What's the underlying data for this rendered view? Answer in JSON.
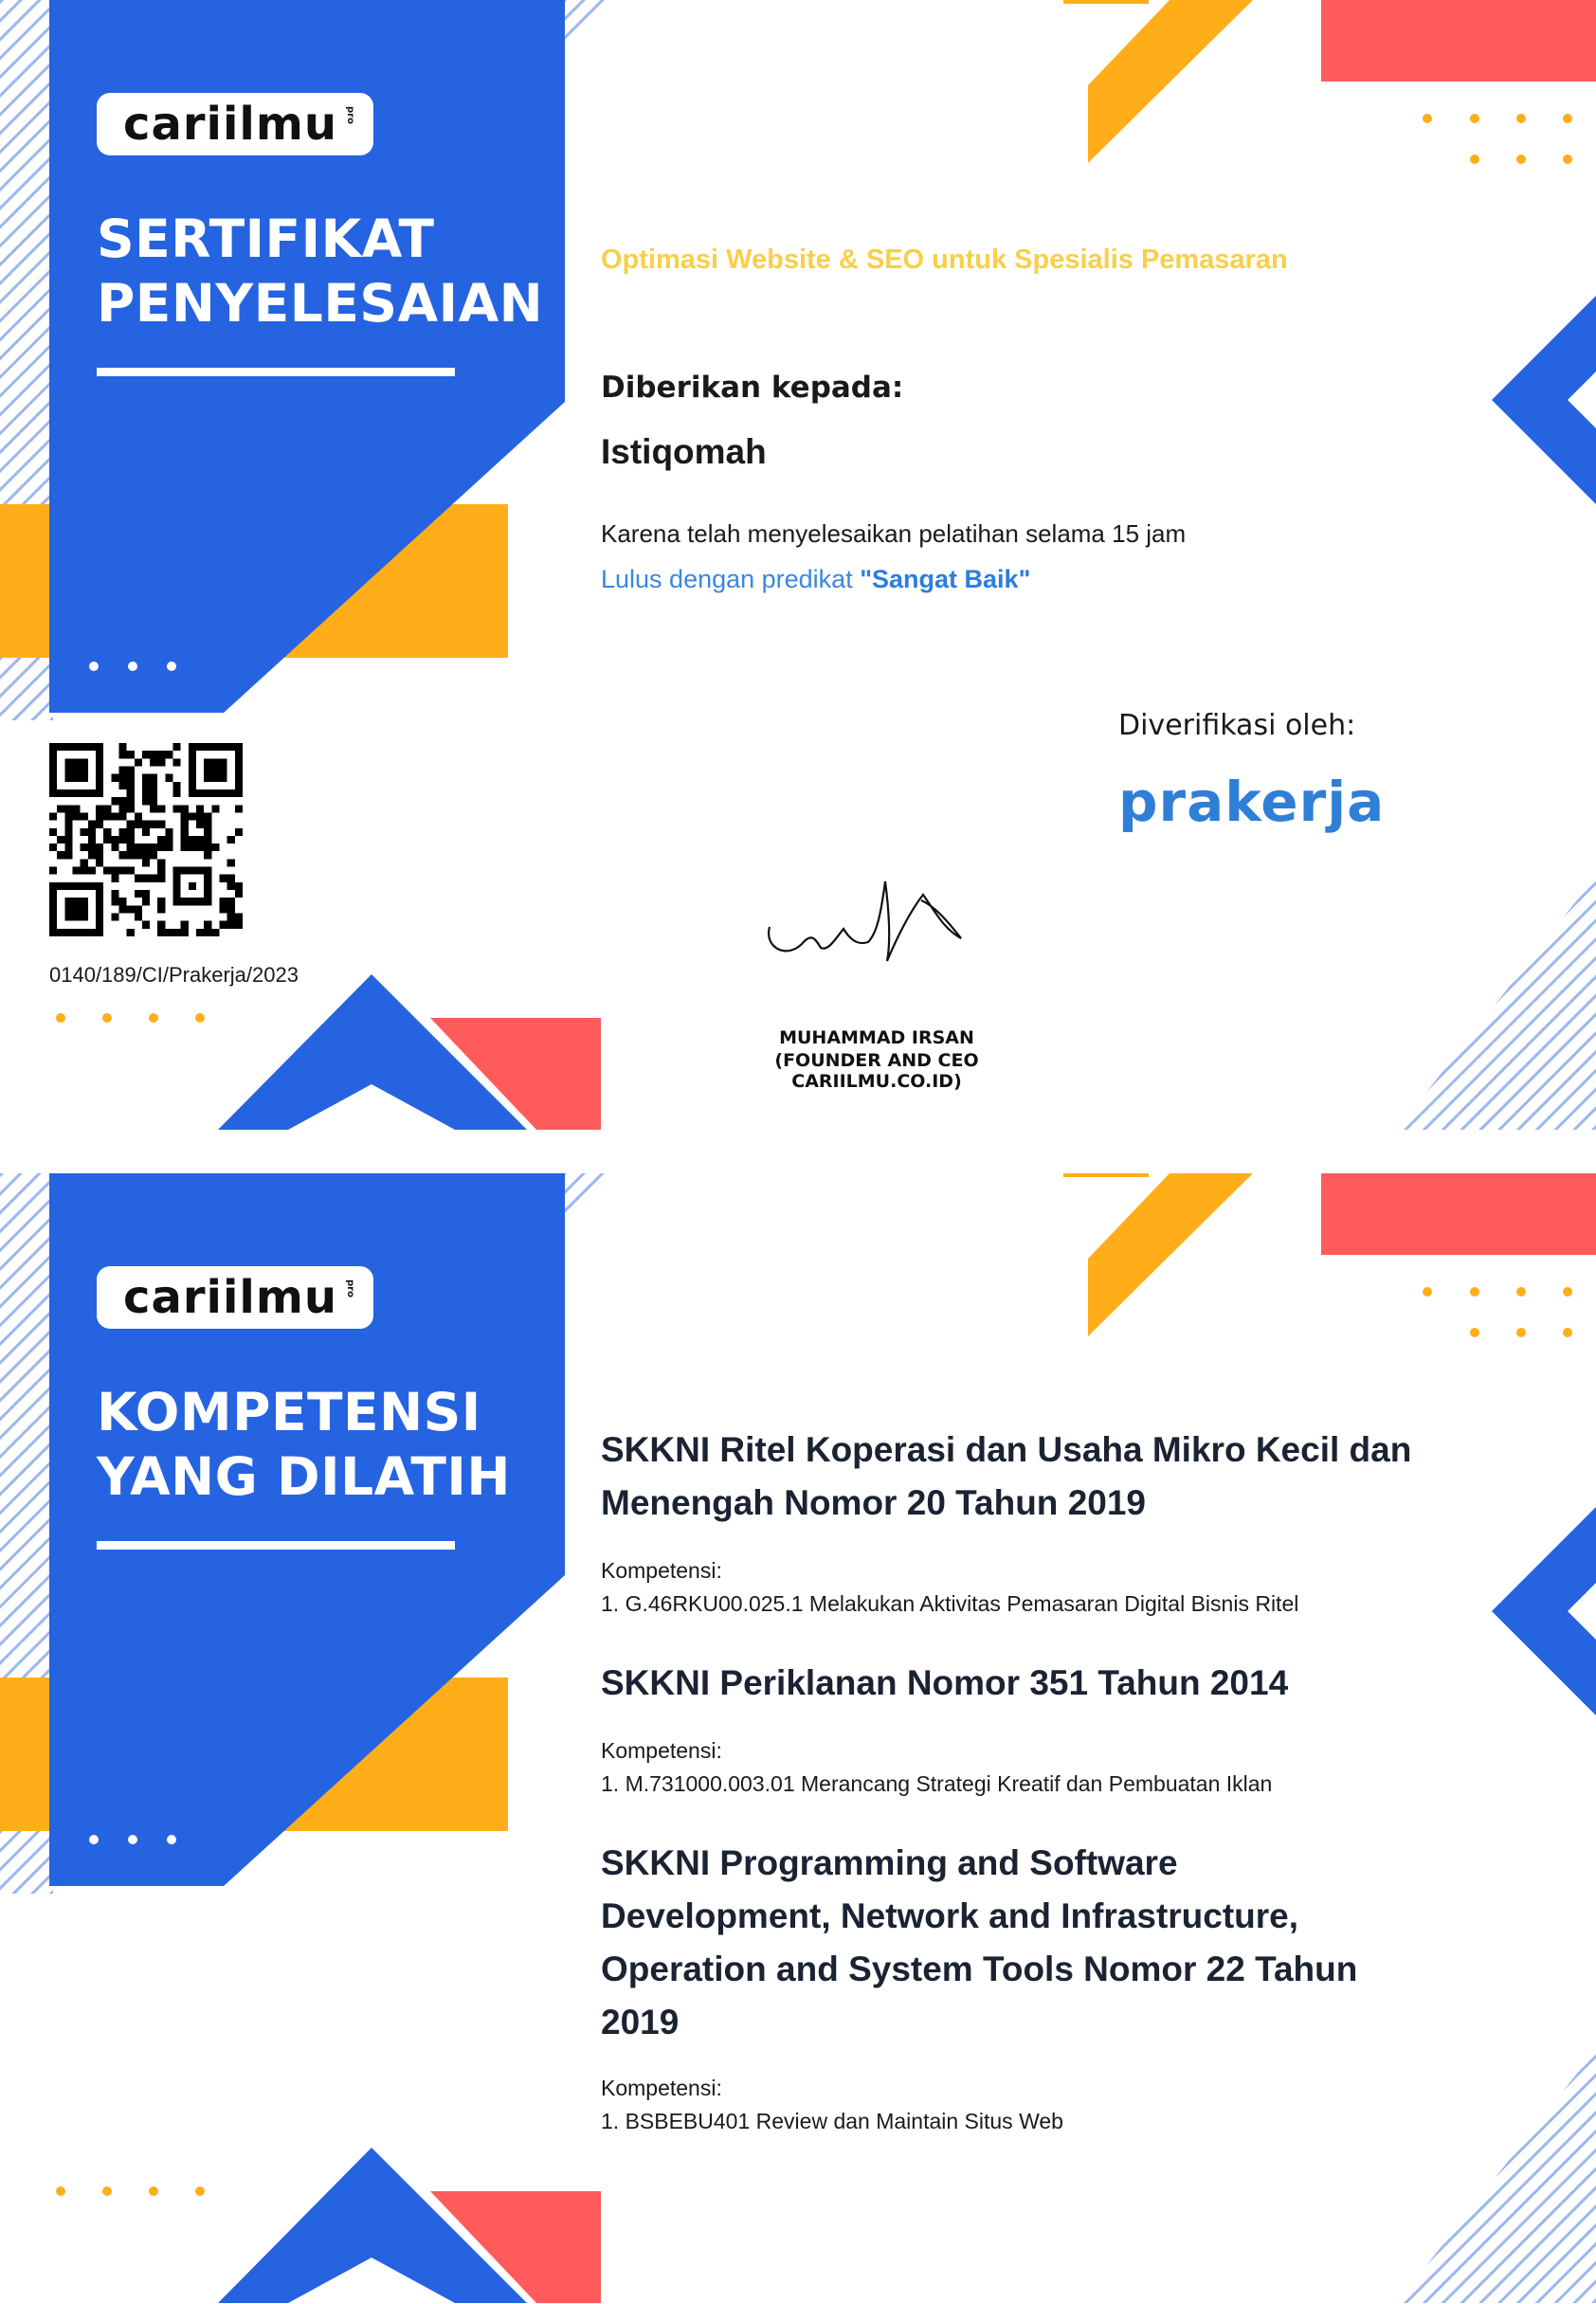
{
  "brand": {
    "logo_text": "cariilmu",
    "logo_suffix": "pro"
  },
  "colors": {
    "blue": "#2563e0",
    "yellow": "#ffae1a",
    "red": "#ff5b5b",
    "white": "#ffffff",
    "grade_blue": "#2b7de0",
    "course_yellow": "#f7cf4a"
  },
  "certificate": {
    "title_line1": "SERTIFIKAT",
    "title_line2": "PENYELESAIAN",
    "course_name": "Optimasi Website & SEO untuk Spesialis Pemasaran",
    "given_label": "Diberikan kepada:",
    "recipient": "Istiqomah",
    "reason": "Karena telah menyelesaikan pelatihan selama 15 jam",
    "grade_prefix": "Lulus dengan predikat ",
    "grade_value": "\"Sangat Baik\"",
    "verified_label": "Diverifikasi oleh:",
    "verifier_logo": "prakerja",
    "certificate_number": "0140/189/CI/Prakerja/2023",
    "signer_name": "MUHAMMAD IRSAN",
    "signer_title": "(FOUNDER AND CEO CARIILMU.CO.ID)",
    "qr_icon": "qr-code-icon"
  },
  "competency": {
    "title_line1": "KOMPETENSI",
    "title_line2": "YANG DILATIH",
    "standards": [
      {
        "title": "SKKNI Ritel Koperasi dan Usaha Mikro Kecil dan Menengah Nomor 20 Tahun 2019",
        "label": "Kompetensi:",
        "items": [
          "1. G.46RKU00.025.1 Melakukan Aktivitas Pemasaran Digital Bisnis Ritel"
        ]
      },
      {
        "title": "SKKNI Periklanan Nomor 351 Tahun 2014",
        "label": "Kompetensi:",
        "items": [
          "1. M.731000.003.01 Merancang Strategi Kreatif dan Pembuatan Iklan"
        ]
      },
      {
        "title": "SKKNI Programming and Software Development, Network and Infrastructure, Operation and System Tools Nomor 22 Tahun 2019",
        "label": "Kompetensi:",
        "items": [
          "1. BSBEBU401 Review dan Maintain Situs Web"
        ]
      }
    ]
  }
}
